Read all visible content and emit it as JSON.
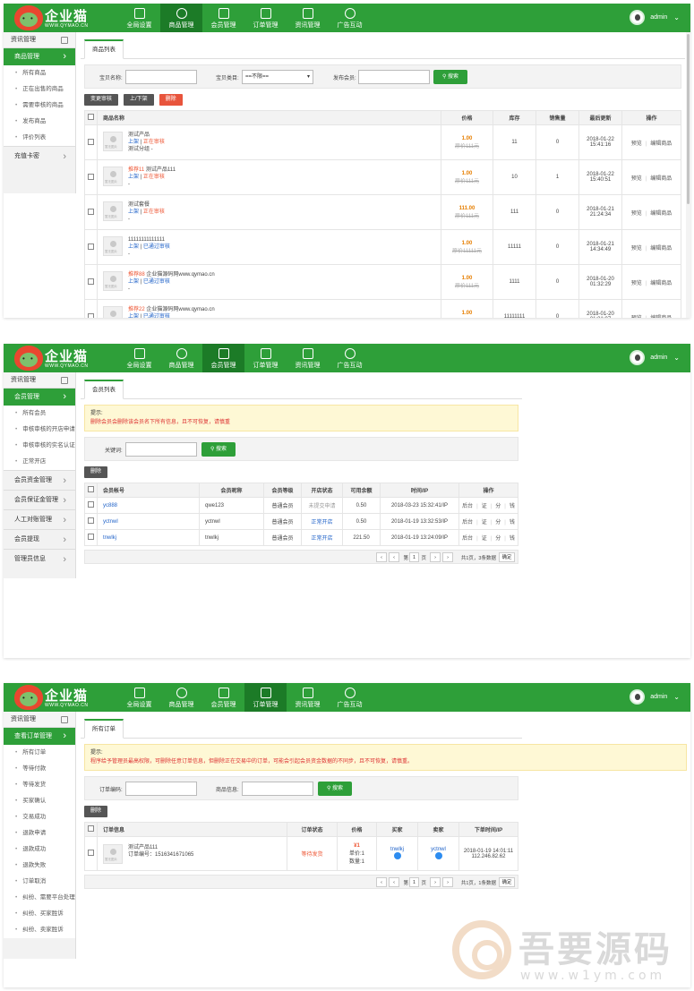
{
  "brand": {
    "name": "企业猫",
    "url": "WWW.QYMAO.CN"
  },
  "nav": [
    "全局设置",
    "商品管理",
    "会员管理",
    "订单管理",
    "资讯管理",
    "广告互动"
  ],
  "user": {
    "name": "admin"
  },
  "sidebar_header": "资讯管理",
  "colors": {
    "primary": "#2e9f39",
    "active_nav": "#1c7b27",
    "danger": "#e8543c",
    "price": "#e67e00"
  },
  "panel1": {
    "sidebar_active": "商品管理",
    "sidebar_items": [
      "所有商品",
      "正在出售的商品",
      "需要审核的商品",
      "发布商品",
      "评价列表"
    ],
    "sidebar_groups": [
      "充值卡密"
    ],
    "tab": "商品列表",
    "filter": {
      "name_label": "宝贝名称:",
      "type_label": "宝贝类目:",
      "type_value": "==不限==",
      "member_label": "发布会员:",
      "search": "搜索"
    },
    "actions": [
      "变更审核",
      "上/下架",
      "删除"
    ],
    "columns": [
      "商品名称",
      "价格",
      "库存",
      "销售量",
      "最后更新",
      "操作"
    ],
    "rows": [
      {
        "prefix": "",
        "title": "测试产品",
        "status1": "上架",
        "status2": "正在审核",
        "extra": "测试分组 -",
        "price": "1.00",
        "old": "原价111元",
        "stock": "11",
        "sales": "0",
        "date": "2018-01-22",
        "time": "15:41:16"
      },
      {
        "prefix": "推荐11",
        "title": "测试产品111",
        "status1": "上架",
        "status2": "正在审核",
        "extra": "-",
        "price": "1.00",
        "old": "原价111元",
        "stock": "10",
        "sales": "1",
        "date": "2018-01-22",
        "time": "15:40:51"
      },
      {
        "prefix": "",
        "title": "测试套餐",
        "status1": "上架",
        "status2": "正在审核",
        "extra": "-",
        "price": "111.00",
        "old": "原价111元",
        "stock": "111",
        "sales": "0",
        "date": "2018-01-21",
        "time": "21:24:34"
      },
      {
        "prefix": "",
        "title": "11111111111111",
        "status1": "上架",
        "status2": "已通过审核",
        "extra": "-",
        "price": "1.00",
        "old": "原价11111元",
        "stock": "11111",
        "sales": "0",
        "date": "2018-01-21",
        "time": "14:34:49"
      },
      {
        "prefix": "推荐88",
        "title": "企业猫源码网www.qymao.cn",
        "status1": "上架",
        "status2": "已通过审核",
        "extra": "-",
        "price": "1.00",
        "old": "原价111元",
        "stock": "1111",
        "sales": "0",
        "date": "2018-01-20",
        "time": "01:32:29"
      },
      {
        "prefix": "推荐22",
        "title": "企业猫源码网www.qymao.cn",
        "status1": "上架",
        "status2": "已通过审核",
        "extra": "-",
        "price": "1.00",
        "old": "原价111元",
        "stock": "11111111",
        "sales": "0",
        "date": "2018-01-20",
        "time": "01:31:07"
      }
    ],
    "ops": [
      "预览",
      "编辑商品"
    ]
  },
  "panel2": {
    "sidebar_active": "会员管理",
    "sidebar_items": [
      "所有会员",
      "审核审核的开店申请",
      "审核审核的实名认证",
      "正常开店"
    ],
    "sidebar_groups": [
      "会员资金管理",
      "会员保证金管理",
      "人工对账管理",
      "会员提现",
      "管理员信息"
    ],
    "tab": "会员列表",
    "tip_title": "提示:",
    "tip_text": "删除会员会删除该会员名下所有信息，且不可恢复，请慎重",
    "filter": {
      "keyword_label": "关键词:",
      "search": "搜索"
    },
    "actions": [
      "删除"
    ],
    "columns": [
      "会员帐号",
      "会员昵称",
      "会员等级",
      "开店状态",
      "可用余额",
      "时间/IP",
      "操作"
    ],
    "rows": [
      {
        "account": "yc888",
        "nick": "qwe123",
        "level": "普通会员",
        "shop": "未提交申请",
        "balance": "0.50",
        "time": "2018-03-23 15:32:41/IP"
      },
      {
        "account": "yctnwl",
        "nick": "yctnwl",
        "level": "普通会员",
        "shop": "正常开店",
        "balance": "0.50",
        "time": "2018-01-19 13:32:53/IP"
      },
      {
        "account": "tnwlkj",
        "nick": "tnwlkj",
        "level": "普通会员",
        "shop": "正常开店",
        "balance": "221.50",
        "time": "2018-01-19 13:24:09/IP"
      }
    ],
    "ops": [
      "后台",
      "证",
      "分",
      "钱"
    ],
    "pager": {
      "page_prefix": "第",
      "page": "1",
      "page_suffix": "页",
      "summary": "共1页，3条数据",
      "go": "确定"
    }
  },
  "panel3": {
    "sidebar_active": "查看订单管理",
    "sidebar_items": [
      "所有订单",
      "等待付款",
      "等待发货",
      "买家确认",
      "交易成功",
      "退款申请",
      "退款成功",
      "退款失败",
      "订单取消",
      "纠纷、需要平台处理",
      "纠纷、买家胜诉",
      "纠纷、卖家胜诉"
    ],
    "tab": "所有订单",
    "tip_title": "提示:",
    "tip_text": "程序给予管理员最高权限，可删除任意订单信息，但删除正在交易中的订单，可能会引起会员资金数据的不同步，且不可恢复，请慎重。",
    "filter": {
      "order_label": "订单编码:",
      "goods_label": "商品信息:",
      "search": "搜索"
    },
    "actions": [
      "删除"
    ],
    "columns": [
      "订单信息",
      "订单状态",
      "价格",
      "买家",
      "卖家",
      "下单时间/IP"
    ],
    "rows": [
      {
        "title": "测试产品111",
        "order_no": "订单编号：1516341671065",
        "status": "等待发货",
        "price": "¥1",
        "unit": "单价:1",
        "qty": "数量:1",
        "buyer": "tnwlkj",
        "seller": "yctnwl",
        "time": "2018-01-19 14:01:11",
        "ip": "112.246.82.62"
      }
    ],
    "pager": {
      "page_prefix": "第",
      "page": "1",
      "page_suffix": "页",
      "summary": "共1页，1条数据",
      "go": "确定"
    }
  },
  "watermark": {
    "text": "吾要源码",
    "url": "www.w1ym.com"
  }
}
